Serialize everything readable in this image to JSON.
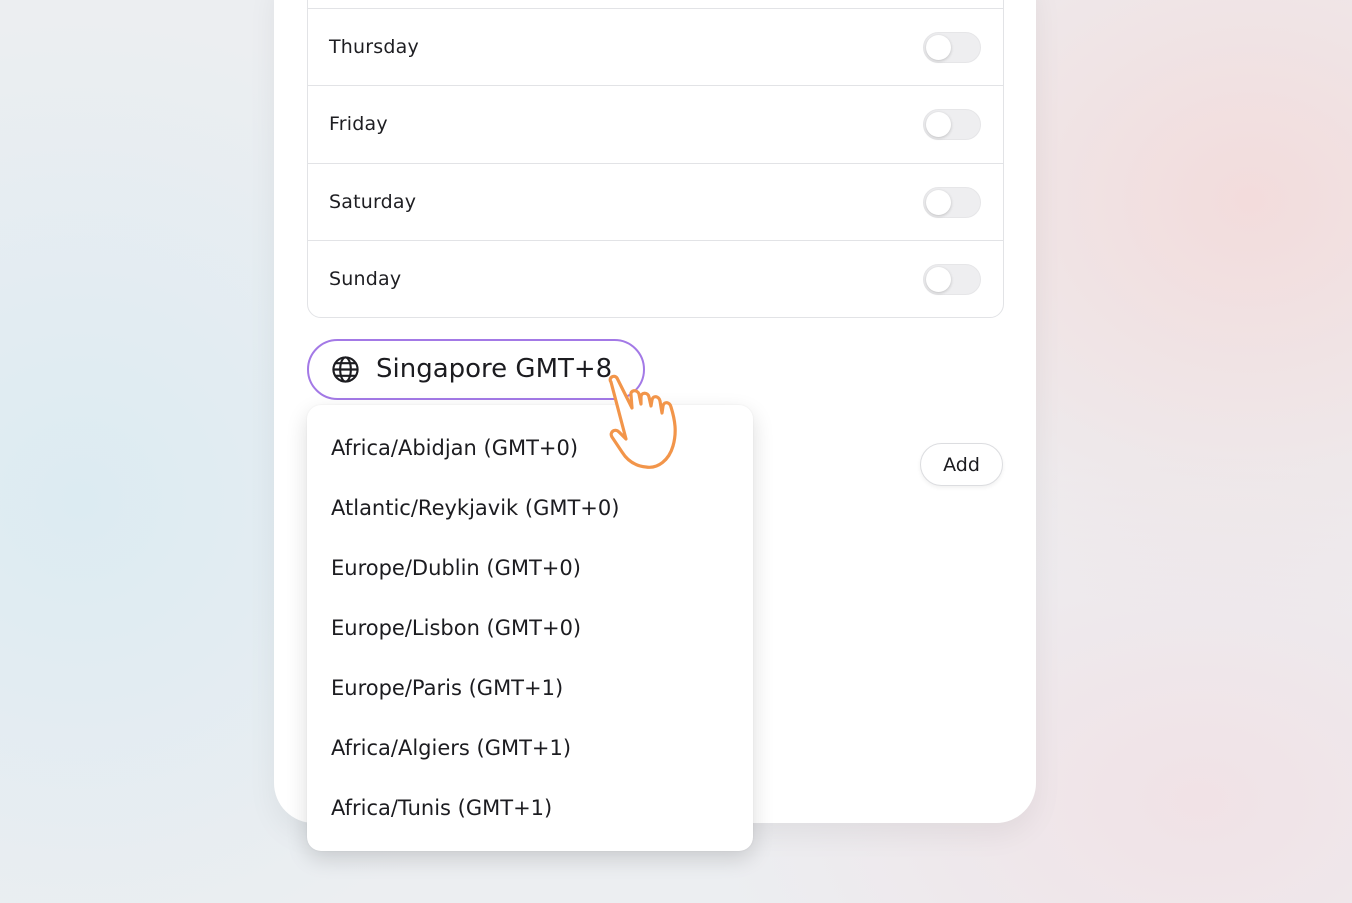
{
  "days": [
    {
      "label": "Thursday",
      "enabled": false
    },
    {
      "label": "Friday",
      "enabled": false
    },
    {
      "label": "Saturday",
      "enabled": false
    },
    {
      "label": "Sunday",
      "enabled": false
    }
  ],
  "timezone": {
    "icon": "globe-icon",
    "selected": "Singapore GMT+8",
    "options": [
      "Africa/Abidjan (GMT+0)",
      "Atlantic/Reykjavik (GMT+0)",
      "Europe/Dublin (GMT+0)",
      "Europe/Lisbon (GMT+0)",
      "Europe/Paris (GMT+1)",
      "Africa/Algiers (GMT+1)",
      "Africa/Tunis (GMT+1)"
    ]
  },
  "actions": {
    "add_label": "Add"
  },
  "colors": {
    "accent": "#a379e6",
    "cursor": "#f2954a"
  },
  "pointer": {
    "icon": "hand-pointer-icon"
  }
}
